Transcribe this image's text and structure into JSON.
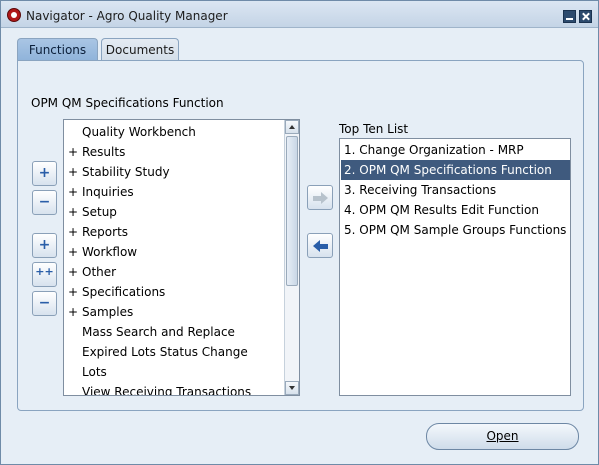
{
  "window": {
    "title": "Navigator - Agro Quality Manager"
  },
  "tabs": [
    {
      "label": "Functions",
      "active": true
    },
    {
      "label": "Documents",
      "active": false
    }
  ],
  "section_label": "OPM QM Specifications Function",
  "tree": {
    "items": [
      {
        "label": "Quality Workbench",
        "expandable": false
      },
      {
        "label": "Results",
        "expandable": true
      },
      {
        "label": "Stability Study",
        "expandable": true
      },
      {
        "label": "Inquiries",
        "expandable": true
      },
      {
        "label": "Setup",
        "expandable": true
      },
      {
        "label": "Reports",
        "expandable": true
      },
      {
        "label": "Workflow",
        "expandable": true
      },
      {
        "label": "Other",
        "expandable": true
      },
      {
        "label": "Specifications",
        "expandable": true
      },
      {
        "label": "Samples",
        "expandable": true
      },
      {
        "label": "Mass Search and Replace",
        "expandable": false
      },
      {
        "label": "Expired Lots Status Change",
        "expandable": false
      },
      {
        "label": "Lots",
        "expandable": false
      },
      {
        "label": "View Receiving Transactions",
        "expandable": false
      }
    ],
    "expand_symbol": "+"
  },
  "side_buttons": {
    "expand": "+",
    "collapse": "−",
    "expand_branch": "+",
    "expand_all": "++",
    "collapse_all": "−"
  },
  "top_ten": {
    "label": "Top Ten List",
    "items": [
      "1. Change Organization - MRP",
      "2. OPM QM Specifications Function",
      "3. Receiving Transactions",
      "4. OPM QM Results Edit Function",
      "5. OPM QM Sample Groups Functions"
    ],
    "selected_index": 1
  },
  "buttons": {
    "open_label": "Open"
  },
  "icons": {
    "app": "oracle-app-icon",
    "minimize": "minimize-icon",
    "close": "close-icon",
    "add_to_list": "arrow-right-icon",
    "remove_from_list": "arrow-left-icon"
  },
  "colors": {
    "selection": "#3f5a7e",
    "accent": "#2a5ea8"
  }
}
